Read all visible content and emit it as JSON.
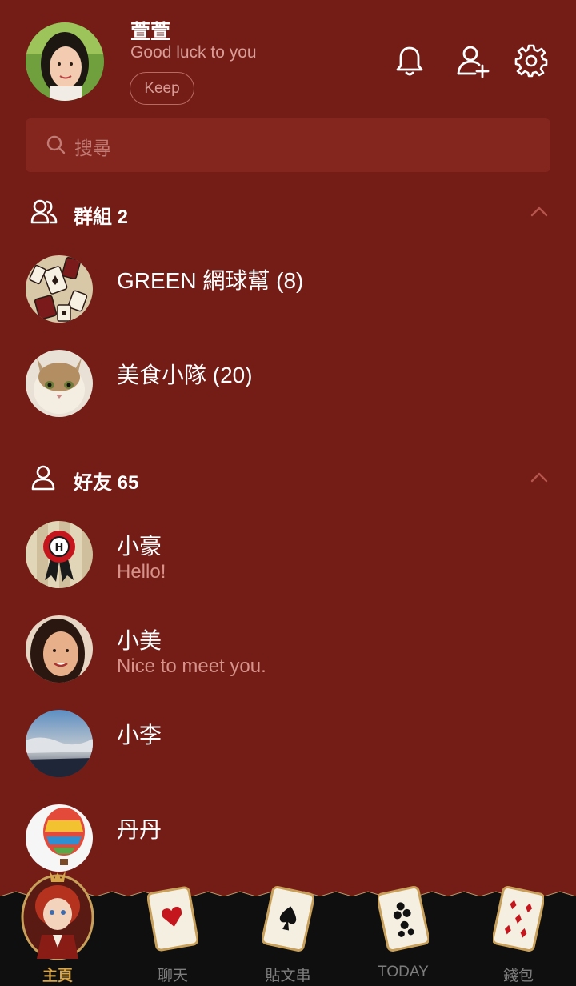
{
  "profile": {
    "name": "萱萱",
    "status": "Good luck to you",
    "keep_label": "Keep"
  },
  "search": {
    "placeholder": "搜尋"
  },
  "groups": {
    "title": "群組 2",
    "items": [
      {
        "title": "GREEN 網球幫 (8)",
        "subtitle": ""
      },
      {
        "title": "美食小隊 (20)",
        "subtitle": ""
      }
    ]
  },
  "friends": {
    "title": "好友 65",
    "items": [
      {
        "title": "小豪",
        "subtitle": "Hello!"
      },
      {
        "title": "小美",
        "subtitle": "Nice to meet you."
      },
      {
        "title": "小李",
        "subtitle": ""
      },
      {
        "title": "丹丹",
        "subtitle": ""
      }
    ]
  },
  "tabs": [
    {
      "label": "主頁",
      "active": true,
      "icon": "home-character-icon"
    },
    {
      "label": "聊天",
      "active": false,
      "icon": "heart-card-icon"
    },
    {
      "label": "貼文串",
      "active": false,
      "icon": "spade-card-icon"
    },
    {
      "label": "TODAY",
      "active": false,
      "icon": "club-card-icon"
    },
    {
      "label": "錢包",
      "active": false,
      "icon": "diamond-card-icon"
    }
  ],
  "colors": {
    "background": "#741c16",
    "search_bg": "#84251e",
    "subtitle": "#d7928a",
    "tabbar": "#0f0f0f",
    "active_tab": "#d7a54a"
  }
}
